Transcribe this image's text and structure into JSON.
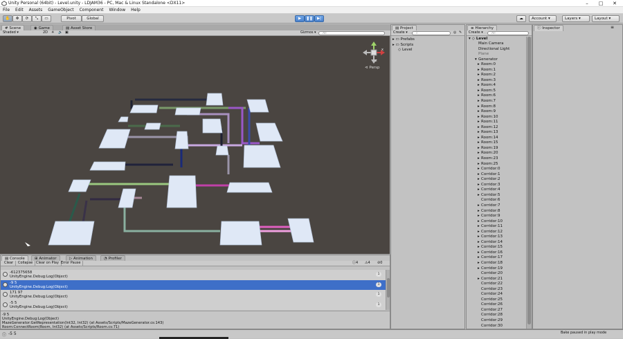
{
  "window": {
    "title": "Unity Personal (64bit) - Level.unity - LDJAM36 - PC, Mac & Linux Standalone <DX11>",
    "controls": [
      "–",
      "□",
      "✕"
    ]
  },
  "menu": [
    "File",
    "Edit",
    "Assets",
    "GameObject",
    "Component",
    "Window",
    "Help"
  ],
  "toolbar": {
    "pivot": "Pivot",
    "global": "Global",
    "account": "Account",
    "layers": "Layers",
    "layout": "Layout"
  },
  "scene": {
    "tabs": [
      "Scene",
      "Game",
      "Asset Store"
    ],
    "shading": "Shaded",
    "mode_2d": "2D",
    "gizmos": "Gizmos",
    "search_placeholder": "All",
    "persp_label": "Persp",
    "axis_x": "x",
    "axis_z": "z"
  },
  "project": {
    "tab": "Project",
    "create": "Create",
    "items": [
      "Prefabs",
      "Scripts",
      "Level"
    ]
  },
  "hierarchy": {
    "tab": "Hierarchy",
    "create": "Create",
    "search_placeholder": "All",
    "scene_name": "Level",
    "items": [
      {
        "label": "Main Camera",
        "depth": 1,
        "arrow": false,
        "dim": false
      },
      {
        "label": "Directional Light",
        "depth": 1,
        "arrow": false,
        "dim": false
      },
      {
        "label": "Plane",
        "depth": 1,
        "arrow": false,
        "dim": true
      },
      {
        "label": "Generator",
        "depth": 1,
        "arrow": true,
        "dim": false
      },
      {
        "label": "Room:0",
        "depth": 2,
        "arrow": true,
        "dim": false
      },
      {
        "label": "Room:1",
        "depth": 2,
        "arrow": true,
        "dim": false
      },
      {
        "label": "Room:2",
        "depth": 2,
        "arrow": true,
        "dim": false
      },
      {
        "label": "Room:3",
        "depth": 2,
        "arrow": true,
        "dim": false
      },
      {
        "label": "Room:4",
        "depth": 2,
        "arrow": true,
        "dim": false
      },
      {
        "label": "Room:5",
        "depth": 2,
        "arrow": true,
        "dim": false
      },
      {
        "label": "Room:6",
        "depth": 2,
        "arrow": true,
        "dim": false
      },
      {
        "label": "Room:7",
        "depth": 2,
        "arrow": true,
        "dim": false
      },
      {
        "label": "Room:8",
        "depth": 2,
        "arrow": true,
        "dim": false
      },
      {
        "label": "Room:9",
        "depth": 2,
        "arrow": true,
        "dim": false
      },
      {
        "label": "Room:10",
        "depth": 2,
        "arrow": true,
        "dim": false
      },
      {
        "label": "Room:11",
        "depth": 2,
        "arrow": true,
        "dim": false
      },
      {
        "label": "Room:12",
        "depth": 2,
        "arrow": true,
        "dim": false
      },
      {
        "label": "Room:13",
        "depth": 2,
        "arrow": true,
        "dim": false
      },
      {
        "label": "Room:14",
        "depth": 2,
        "arrow": true,
        "dim": false
      },
      {
        "label": "Room:15",
        "depth": 2,
        "arrow": true,
        "dim": false
      },
      {
        "label": "Room:19",
        "depth": 2,
        "arrow": true,
        "dim": false
      },
      {
        "label": "Room:20",
        "depth": 2,
        "arrow": true,
        "dim": false
      },
      {
        "label": "Room:23",
        "depth": 2,
        "arrow": true,
        "dim": false
      },
      {
        "label": "Room:25",
        "depth": 2,
        "arrow": true,
        "dim": false
      },
      {
        "label": "Corridor:0",
        "depth": 2,
        "arrow": true,
        "dim": false
      },
      {
        "label": "Corridor:1",
        "depth": 2,
        "arrow": true,
        "dim": false
      },
      {
        "label": "Corridor:2",
        "depth": 2,
        "arrow": true,
        "dim": false
      },
      {
        "label": "Corridor:3",
        "depth": 2,
        "arrow": true,
        "dim": false
      },
      {
        "label": "Corridor:4",
        "depth": 2,
        "arrow": true,
        "dim": false
      },
      {
        "label": "Corridor:5",
        "depth": 2,
        "arrow": true,
        "dim": false
      },
      {
        "label": "Corridor:6",
        "depth": 2,
        "arrow": false,
        "dim": false
      },
      {
        "label": "Corridor:7",
        "depth": 2,
        "arrow": true,
        "dim": false
      },
      {
        "label": "Corridor:8",
        "depth": 2,
        "arrow": true,
        "dim": false
      },
      {
        "label": "Corridor:9",
        "depth": 2,
        "arrow": true,
        "dim": false
      },
      {
        "label": "Corridor:10",
        "depth": 2,
        "arrow": true,
        "dim": false
      },
      {
        "label": "Corridor:11",
        "depth": 2,
        "arrow": true,
        "dim": false
      },
      {
        "label": "Corridor:12",
        "depth": 2,
        "arrow": true,
        "dim": false
      },
      {
        "label": "Corridor:13",
        "depth": 2,
        "arrow": true,
        "dim": false
      },
      {
        "label": "Corridor:14",
        "depth": 2,
        "arrow": true,
        "dim": false
      },
      {
        "label": "Corridor:15",
        "depth": 2,
        "arrow": true,
        "dim": false
      },
      {
        "label": "Corridor:16",
        "depth": 2,
        "arrow": true,
        "dim": false
      },
      {
        "label": "Corridor:17",
        "depth": 2,
        "arrow": true,
        "dim": false
      },
      {
        "label": "Corridor:18",
        "depth": 2,
        "arrow": true,
        "dim": false
      },
      {
        "label": "Corridor:19",
        "depth": 2,
        "arrow": true,
        "dim": false
      },
      {
        "label": "Corridor:20",
        "depth": 2,
        "arrow": false,
        "dim": false
      },
      {
        "label": "Corridor:21",
        "depth": 2,
        "arrow": true,
        "dim": false
      },
      {
        "label": "Corridor:22",
        "depth": 2,
        "arrow": false,
        "dim": false
      },
      {
        "label": "Corridor:23",
        "depth": 2,
        "arrow": false,
        "dim": false
      },
      {
        "label": "Corridor:24",
        "depth": 2,
        "arrow": false,
        "dim": false
      },
      {
        "label": "Corridor:25",
        "depth": 2,
        "arrow": false,
        "dim": false
      },
      {
        "label": "Corridor:26",
        "depth": 2,
        "arrow": false,
        "dim": false
      },
      {
        "label": "Corridor:27",
        "depth": 2,
        "arrow": false,
        "dim": false
      },
      {
        "label": "Corridor:28",
        "depth": 2,
        "arrow": false,
        "dim": false
      },
      {
        "label": "Corridor:29",
        "depth": 2,
        "arrow": false,
        "dim": false
      },
      {
        "label": "Corridor:30",
        "depth": 2,
        "arrow": false,
        "dim": false
      },
      {
        "label": "Corridor:31",
        "depth": 2,
        "arrow": true,
        "dim": false
      }
    ]
  },
  "inspector": {
    "tab": "Inspector"
  },
  "console": {
    "tabs": [
      "Console",
      "Animator",
      "Animation",
      "Profiler"
    ],
    "buttons": [
      "Clear",
      "Collapse",
      "Clear on Play",
      "Error Pause"
    ],
    "counts": [
      "4",
      "4",
      "0"
    ],
    "rows": [
      {
        "line1": "-612375658",
        "line2": "UnityEngine.Debug:Log(Object)",
        "count": "1",
        "selected": false
      },
      {
        "line1": "-9 5",
        "line2": "UnityEngine.Debug:Log(Object)",
        "count": "1",
        "selected": true
      },
      {
        "line1": "171 97",
        "line2": "UnityEngine.Debug:Log(Object)",
        "count": "1",
        "selected": false
      },
      {
        "line1": "-5 5",
        "line2": "UnityEngine.Debug:Log(Object)",
        "count": "1",
        "selected": false
      }
    ],
    "detail": [
      "-9 5",
      "UnityEngine.Debug:Log(Object)",
      "MazeGenerator:GetRepresentation(Int32, Int32) (at Assets/Scripts/MazeGenerator.cs:143)",
      "Room:ConnectRoom(Room, Int32) (at Assets/Scripts/Room.cs:71)"
    ]
  },
  "status": {
    "message": "-5 5",
    "baking": "Bake paused in play mode"
  },
  "colors": {
    "scene_bg": "#4a4541",
    "selection": "#3e6fc8",
    "room_fill": "#dfe8f6"
  }
}
